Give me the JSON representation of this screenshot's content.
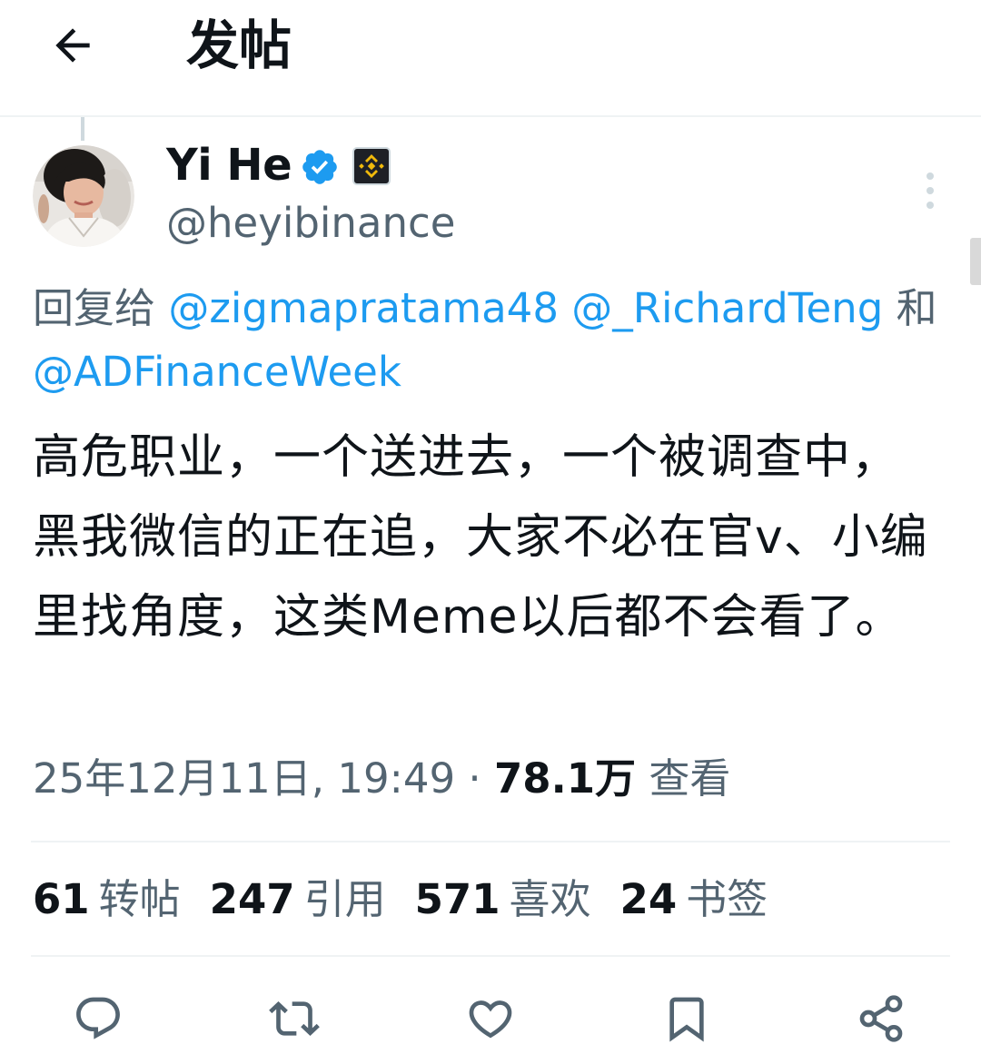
{
  "header": {
    "title": "发帖",
    "back_icon": "arrow-left-icon"
  },
  "author": {
    "display_name": "Yi He",
    "handle": "@heyibinance",
    "verified_icon": "verified-badge-icon",
    "affiliate_icon": "binance-logo-icon",
    "more_icon": "more-vertical-icon"
  },
  "reply": {
    "prefix": "回复给 ",
    "mentions": [
      "@zigmapratama48",
      "@_RichardTeng",
      "@ADFinanceWeek"
    ],
    "joiner": " 和"
  },
  "tweet": {
    "text": "高危职业，一个送进去，一个被调查中，黑我微信的正在追，大家不必在官v、小编里找角度，这类Meme以后都不会看了。"
  },
  "meta": {
    "timestamp": "25年12月11日, 19:49",
    "separator": " · ",
    "views": "78.1万",
    "views_label": " 查看"
  },
  "stats": [
    {
      "count": "61",
      "label": "转帖"
    },
    {
      "count": "247",
      "label": "引用"
    },
    {
      "count": "571",
      "label": "喜欢"
    },
    {
      "count": "24",
      "label": "书签"
    }
  ],
  "actions": [
    {
      "icon": "reply-icon"
    },
    {
      "icon": "repost-icon"
    },
    {
      "icon": "like-icon"
    },
    {
      "icon": "bookmark-icon"
    },
    {
      "icon": "share-icon"
    }
  ],
  "colors": {
    "accent": "#1d9bf0",
    "secondary_text": "#536471",
    "primary_text": "#0f1419",
    "divider": "#eff3f4",
    "binance_yellow": "#f0b90b"
  }
}
